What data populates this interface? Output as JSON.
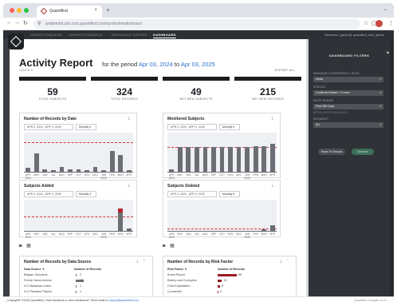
{
  "browser": {
    "tab_title": "Quantifind",
    "url": "jwdjmednt.sbv.cosi.quantifind.com/quotesbmatvsboard",
    "colors": {
      "close": "#ff5f57",
      "minimize": "#febc2e",
      "maximize": "#28c840"
    }
  },
  "app_nav": {
    "items": [
      "GRAPHYTEQUEUE",
      "GRAPHYTESEARCH",
      "RESOURCE CENTER",
      "DASHBOARD"
    ],
    "active": "DASHBOARD",
    "welcome": "Welcome, j.jason@ quantifind_test_queue"
  },
  "report": {
    "title": "Activity Report",
    "period_prefix": "for the period",
    "start": "Apr 03, 2024",
    "to": "to",
    "end": "Apr 03, 2025",
    "lance": "LANCE ▾",
    "export": "EXPORT ALL"
  },
  "stats": [
    {
      "value": "59",
      "label": "TOTAL SUBJECTS"
    },
    {
      "value": "324",
      "label": "TOTAL RECORDS"
    },
    {
      "value": "49",
      "label": "NET NEW SUBJECTS"
    },
    {
      "value": "215",
      "label": "NET NEW RECORDS"
    }
  ],
  "range_text": "APR 3, 2024 - APR 3, 2025",
  "granularity": "Monthly ▾",
  "month_labels": [
    "APR 2024",
    "MAY",
    "JUN",
    "JUL",
    "AUG",
    "SEP",
    "OCT",
    "NOV",
    "DEC",
    "JAN 2025",
    "FEB",
    "MAR",
    "APR"
  ],
  "chart_data": [
    {
      "type": "bar",
      "title": "Number of Records by Date",
      "categories": [
        "APR 2024",
        "MAY",
        "JUN",
        "JUL",
        "AUG",
        "SEP",
        "OCT",
        "NOV",
        "DEC",
        "JAN 2025",
        "FEB",
        "MAR",
        "APR"
      ],
      "values": [
        5,
        22,
        4,
        3,
        6,
        4,
        4,
        3,
        6,
        3,
        24,
        20,
        3
      ],
      "ylim": [
        0,
        45
      ],
      "reference_line": 34,
      "color": "#6b6e73"
    },
    {
      "type": "bar",
      "title": "Monitored Subjects",
      "categories": [
        "APR 2024",
        "MAY",
        "JUN",
        "JUL",
        "AUG",
        "SEP",
        "OCT",
        "NOV",
        "DEC",
        "JAN 2025",
        "FEB",
        "MAR",
        "APR"
      ],
      "values": [
        5,
        38,
        38,
        38,
        39,
        38,
        39,
        39,
        39,
        39,
        40,
        40,
        43
      ],
      "ylim": [
        0,
        60
      ],
      "reference_line": 38,
      "color": "#6b6e73"
    },
    {
      "type": "bar",
      "title": "Subjects Added",
      "categories": [
        "APR 2024",
        "MAY",
        "JUN",
        "JUL",
        "AUG",
        "SEP",
        "OCT",
        "NOV",
        "DEC",
        "JAN 2025",
        "FEB",
        "MAR",
        "APR"
      ],
      "values": [
        0,
        0,
        0,
        0,
        0,
        0,
        0,
        0,
        0,
        0,
        1,
        40,
        6
      ],
      "ylim": [
        0,
        55
      ],
      "reference_line": 26,
      "color": "#6b6e73",
      "highlight_color": "#b8232b"
    },
    {
      "type": "bar",
      "title": "Subjects Deleted",
      "categories": [
        "APR 2024",
        "MAY",
        "JUN",
        "JUL",
        "AUG",
        "SEP",
        "OCT",
        "NOV",
        "DEC",
        "JAN 2025",
        "FEB",
        "MAR",
        "APR"
      ],
      "values": [
        0,
        0,
        0,
        0,
        0,
        0,
        0,
        0,
        0,
        1,
        1,
        4,
        10
      ],
      "ylim": [
        0,
        50
      ],
      "reference_line": 5,
      "color": "#6b6e73"
    },
    {
      "type": "bar",
      "title": "Number of Records by Data Source",
      "categories": [
        "Belgian Sanctions",
        "French News Archive",
        "ICIJ Bahamas Leaks",
        "ICIJ Paradise Papers"
      ],
      "values": [
        2,
        17,
        1,
        1
      ],
      "color": "#6b6e73"
    },
    {
      "type": "bar",
      "title": "Number of Records by Risk Factor",
      "categories": [
        "Arrest Report",
        "Bribery and Corruption",
        "Child Exploitation",
        "Counterfeit"
      ],
      "values": [
        66,
        15,
        8,
        2
      ],
      "color": "#9b1c24"
    }
  ],
  "cards": {
    "c1": "Number of Records by Date",
    "c2": "Monitored Subjects",
    "c3": "Subjects Added",
    "c4": "Subjects Deleted"
  },
  "tables": {
    "source": {
      "title": "Number of Records by Data Source",
      "col1": "Data Source ▼",
      "col2": "Number of Records",
      "rows": [
        {
          "name": "Belgian Sanctions",
          "count": "2"
        },
        {
          "name": "French News Archive",
          "count": "17"
        },
        {
          "name": "ICIJ Bahamas Leaks",
          "count": "1"
        },
        {
          "name": "ICIJ Paradise Papers",
          "count": "1"
        }
      ]
    },
    "risk": {
      "title": "Number of Records by Risk Factor",
      "col1": "Risk Factor ▼",
      "col2": "Number of Records",
      "rows": [
        {
          "name": "Arrest Report",
          "count": "66"
        },
        {
          "name": "Bribery and Corruption",
          "count": "15"
        },
        {
          "name": "Child Exploitation",
          "count": "8"
        },
        {
          "name": "Counterfeit",
          "count": "2"
        }
      ]
    }
  },
  "filters": {
    "title": "DASHBOARD FILTERS",
    "confidence_label": "MINIMUM CONFIDENCE LEVEL",
    "confidence_value": "Weak",
    "status_label": "STATUS",
    "status_value": "Confirmed Match + 4 more",
    "date_label": "DATE RANGE",
    "date_value": "Past 365 Days",
    "date_sub": "APR 03, 2024 TO 2025-04-03",
    "segment_label": "SEGMENT",
    "segment_value": "ALL",
    "reset": "Reset To Defaults",
    "generate": "Generate"
  },
  "footer": {
    "text": "Graphyte® ©2025 Quantifind | Have feedback or need assistance? Send email to",
    "email": "support@quantifind.com",
    "version": "Quantifind Graphyte v3.3.1"
  }
}
